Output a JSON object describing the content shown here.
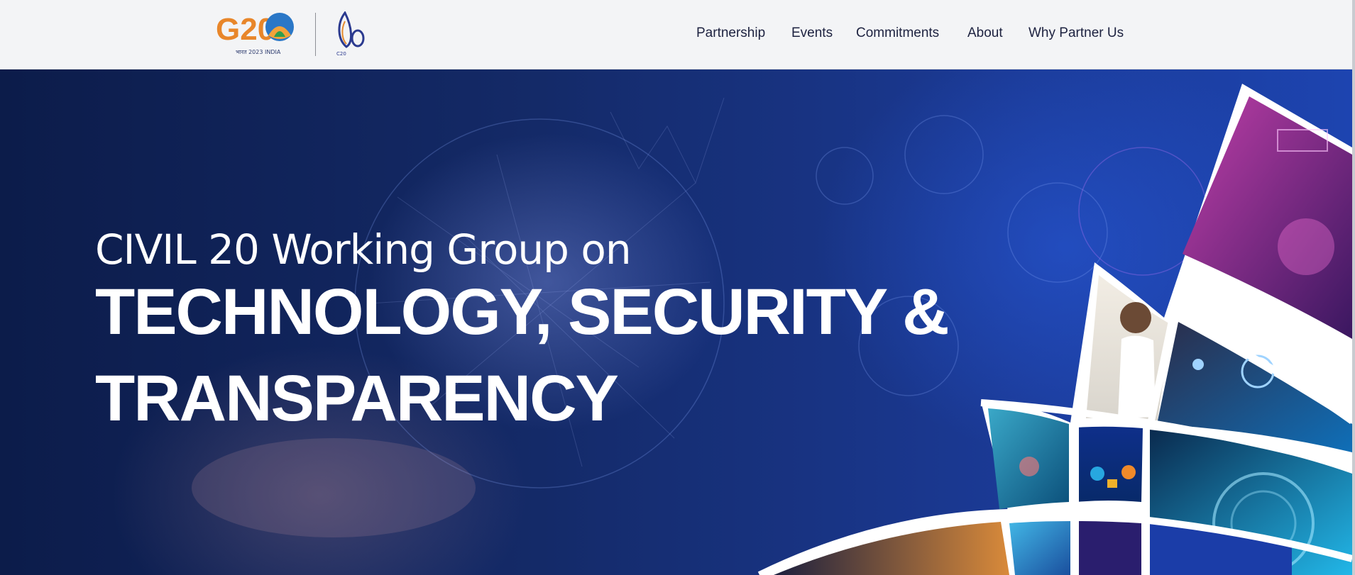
{
  "header": {
    "g20_logo": {
      "text": "G20",
      "subtext": "भारत 2023 INDIA"
    },
    "c20_logo": {
      "text": "C20"
    },
    "nav": [
      {
        "label": "Partnership"
      },
      {
        "label": "Events"
      },
      {
        "label": "Commitments"
      },
      {
        "label": "About"
      },
      {
        "label": "Why Partner Us"
      }
    ]
  },
  "hero": {
    "line1": "CIVIL 20 Working Group on",
    "line2": "TECHNOLOGY, SECURITY &",
    "line3": "TRANSPARENCY"
  },
  "colors": {
    "header_bg": "#f3f4f6",
    "nav_text": "#1d2240",
    "hero_dark": "#0c1c4a",
    "hero_blue": "#1d44b0",
    "hero_text": "#ffffff"
  }
}
